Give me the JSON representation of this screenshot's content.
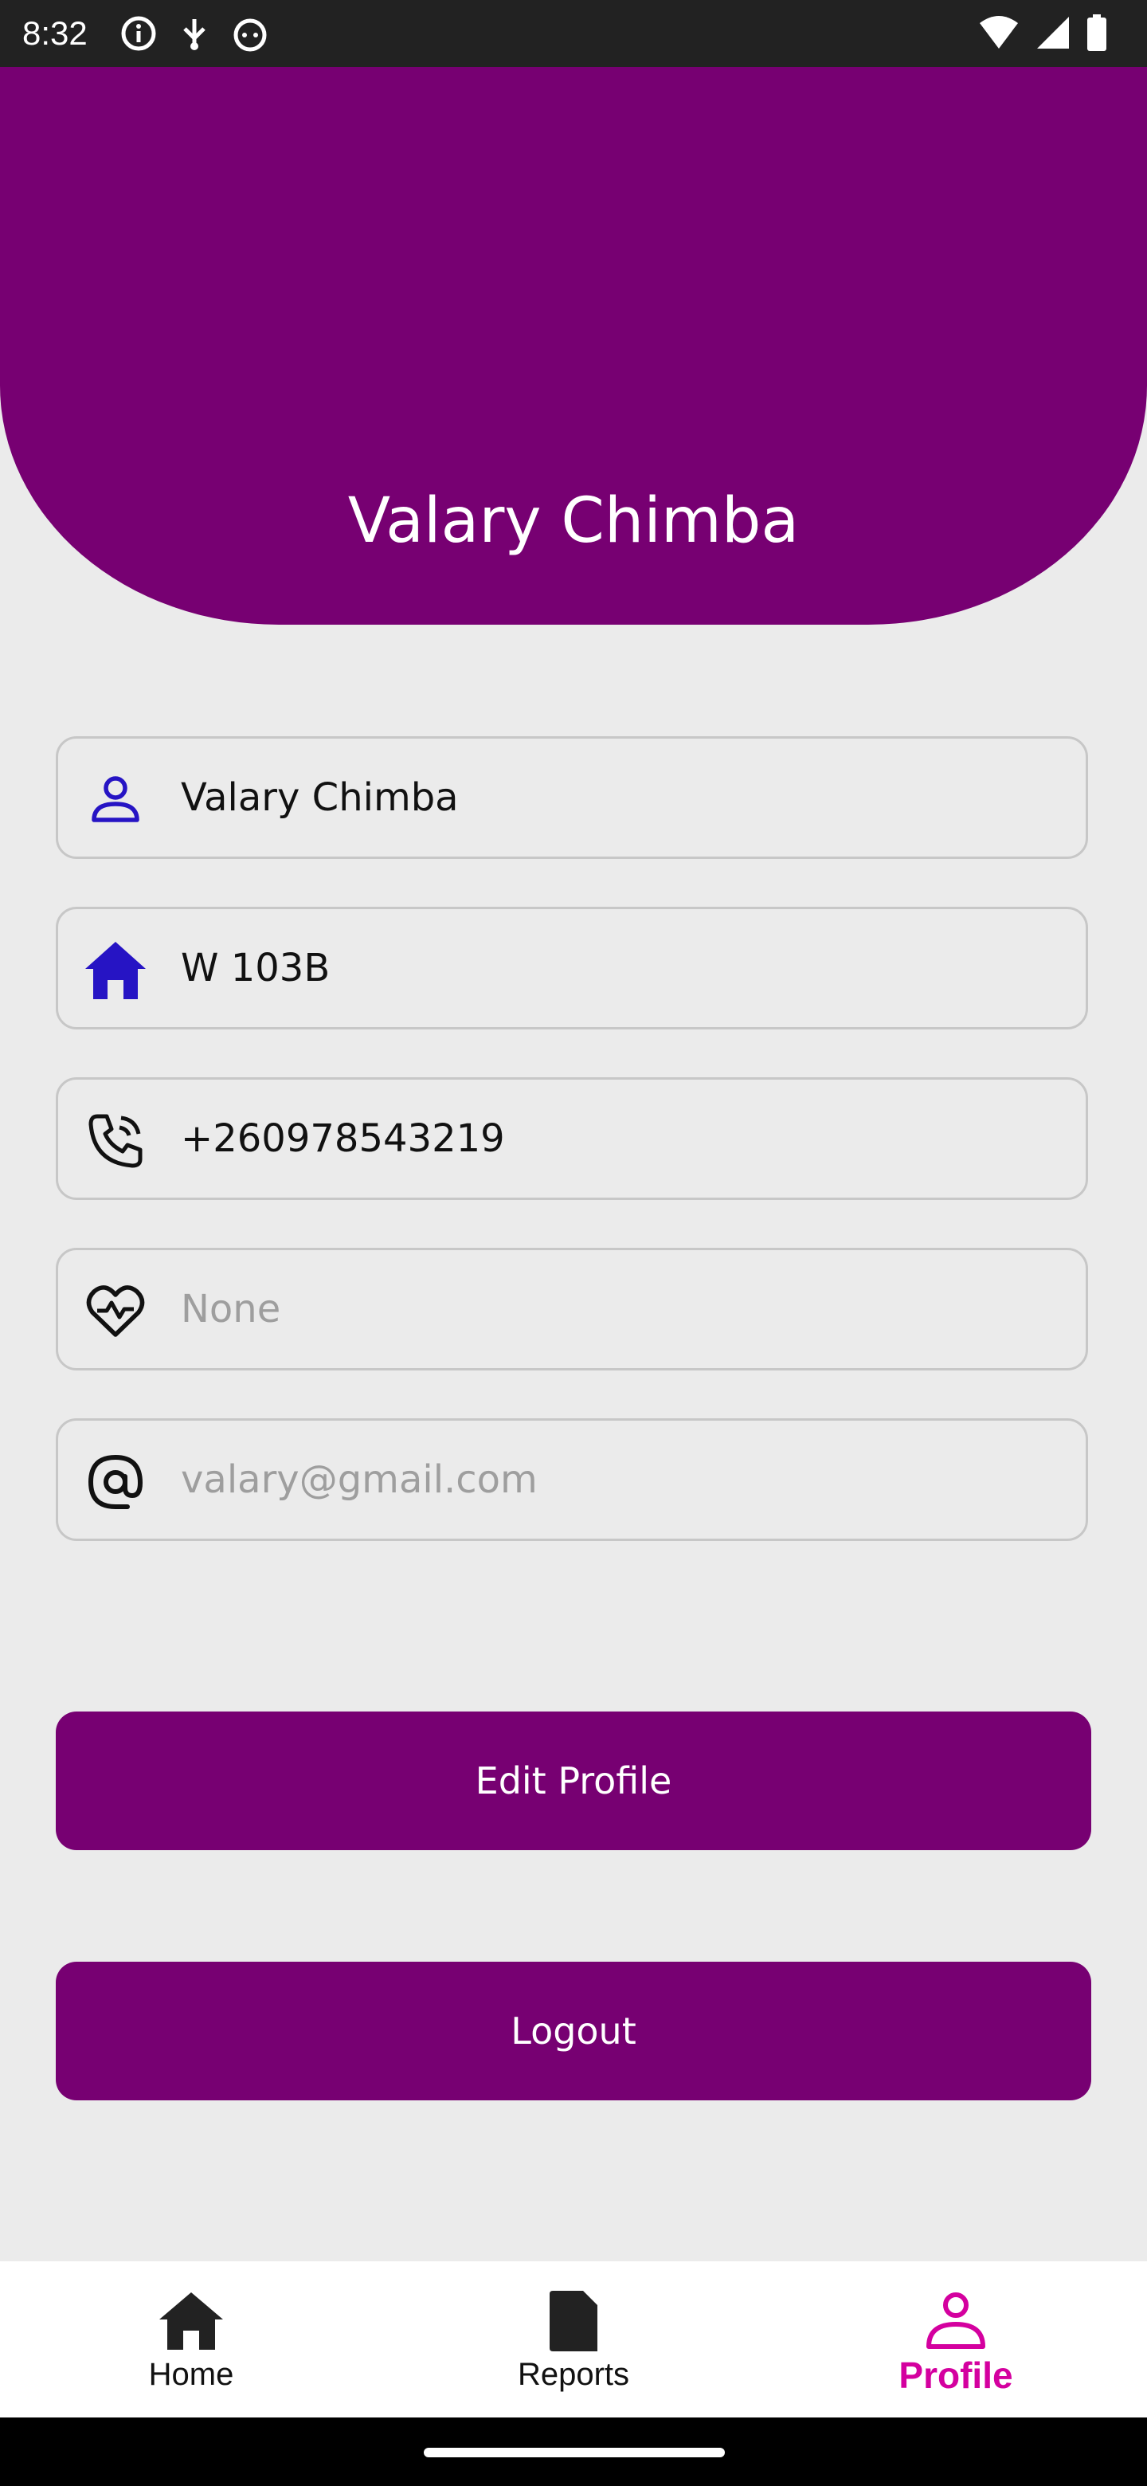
{
  "status_bar": {
    "time": "8:32"
  },
  "profile": {
    "header_name": "Valary Chimba"
  },
  "fields": {
    "name": {
      "value": "Valary Chimba",
      "icon": "person-icon"
    },
    "address": {
      "value": "W 103B",
      "icon": "home-icon"
    },
    "phone": {
      "value": "+260978543219",
      "icon": "phone-icon"
    },
    "health": {
      "placeholder": "None",
      "icon": "heart-pulse-icon"
    },
    "email": {
      "placeholder": "valary@gmail.com",
      "icon": "at-icon"
    }
  },
  "buttons": {
    "edit_profile": "Edit Profile",
    "logout": "Logout"
  },
  "bottom_nav": {
    "items": [
      {
        "label": "Home",
        "icon": "home-icon"
      },
      {
        "label": "Reports",
        "icon": "document-icon"
      },
      {
        "label": "Profile",
        "icon": "person-icon",
        "active": true
      }
    ]
  },
  "colors": {
    "primary": "#770072",
    "active_nav": "#d4009f",
    "field_icon_blue": "#2614c4"
  }
}
